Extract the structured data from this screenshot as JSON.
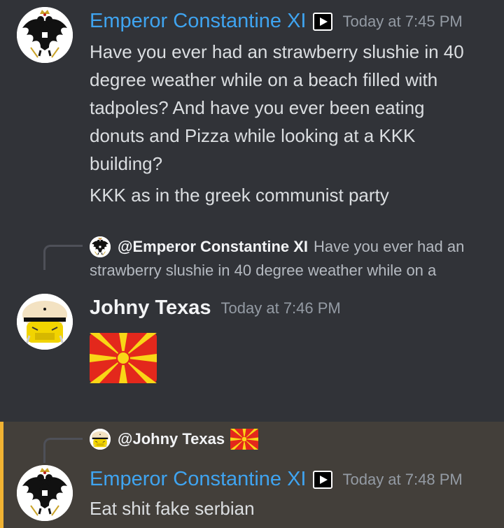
{
  "messages": [
    {
      "author": "Emperor Constantine XI",
      "timestamp": "Today at 7:45 PM",
      "lines": [
        "Have you ever had an strawberry slushie in 40 degree weather while on a beach filled with tadpoles? And have you ever been eating donuts and Pizza while looking at a KKK building?",
        "KKK as in the greek communist party"
      ]
    },
    {
      "reply": {
        "mention": "@Emperor Constantine XI",
        "preview_line1": "Have you ever had an",
        "preview_line2": "strawberry slushie in 40 degree weather while on a"
      },
      "author": "Johny Texas",
      "timestamp": "Today at 7:46 PM",
      "attachment": "north-macedonia-flag-emoji"
    },
    {
      "reply": {
        "mention": "@Johny Texas",
        "emoji": "north-macedonia-flag-emoji"
      },
      "author": "Emperor Constantine XI",
      "timestamp": "Today at 7:48 PM",
      "lines": [
        "Eat shit fake serbian"
      ]
    }
  ],
  "colors": {
    "background": "#313338",
    "highlight_bg": "#433f3a",
    "highlight_bar": "#f0b232",
    "username_blue": "#3fa4f0",
    "timestamp": "#949ba4",
    "text": "#dbdee1"
  },
  "icons": {
    "app_badge": "play-button-icon",
    "eagle_avatar": "double-headed-eagle-emblem",
    "johny_avatar": "cartoon-face-with-hat"
  }
}
